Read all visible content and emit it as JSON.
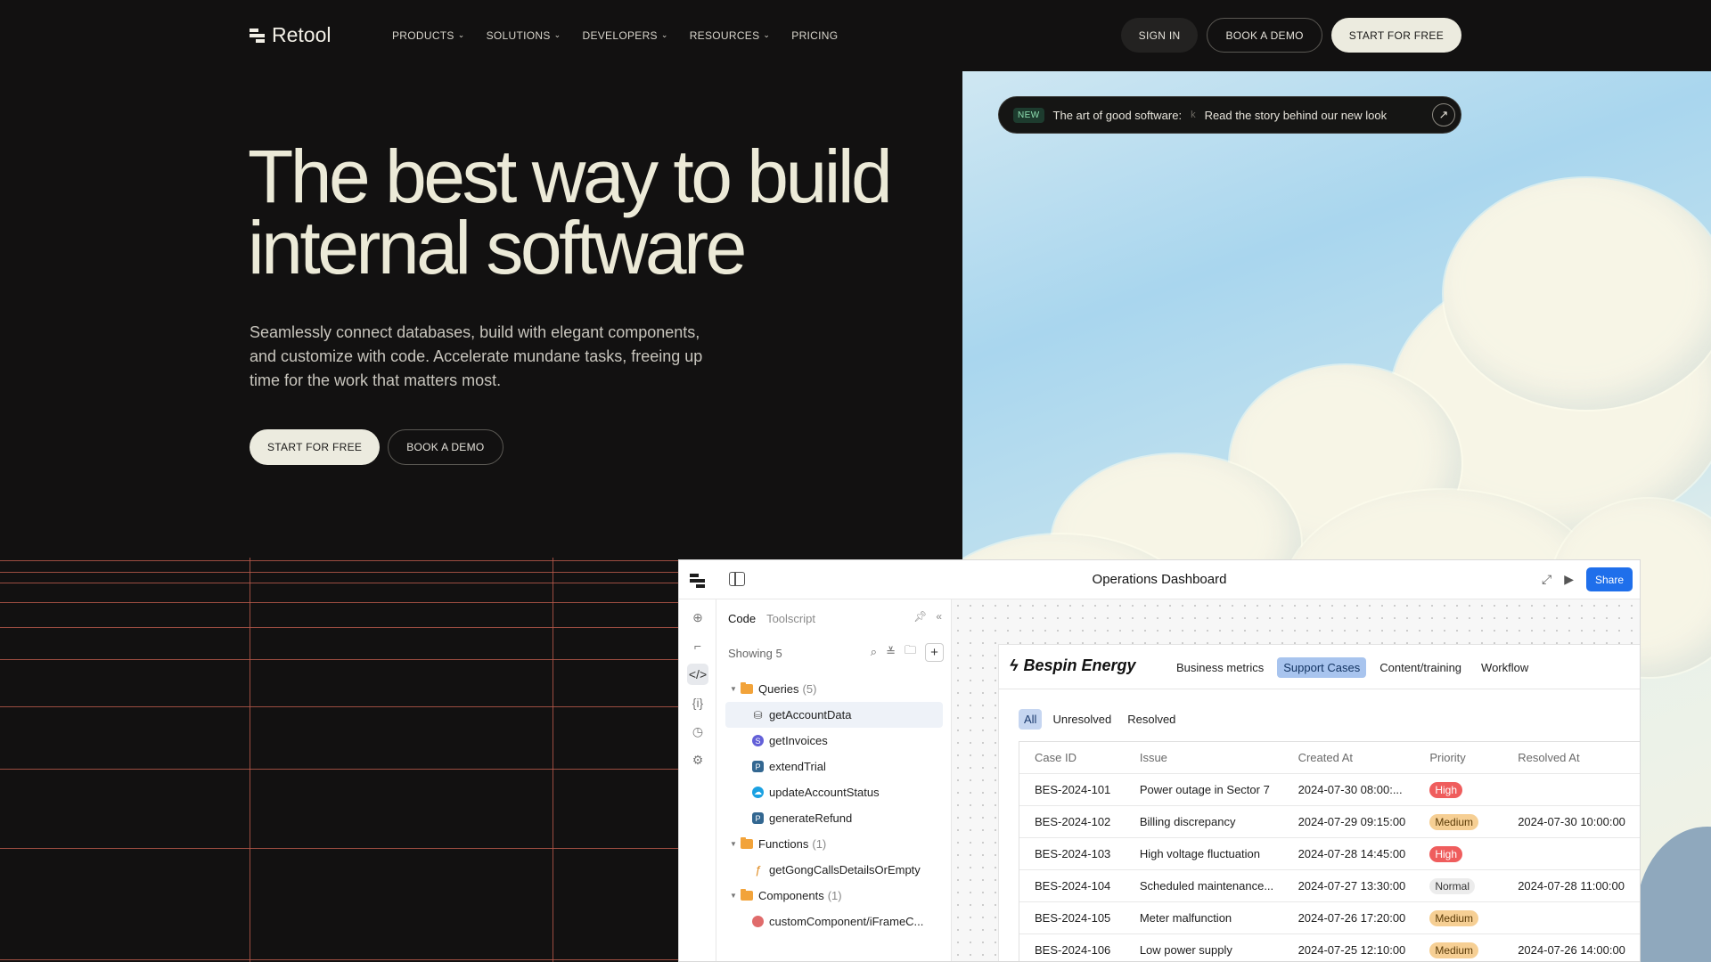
{
  "nav": {
    "brand": "Retool",
    "links": [
      {
        "label": "PRODUCTS",
        "has_menu": true
      },
      {
        "label": "SOLUTIONS",
        "has_menu": true
      },
      {
        "label": "DEVELOPERS",
        "has_menu": true
      },
      {
        "label": "RESOURCES",
        "has_menu": true
      },
      {
        "label": "PRICING",
        "has_menu": false
      }
    ],
    "sign_in": "SIGN IN",
    "book_demo": "BOOK A DEMO",
    "start_free": "START FOR FREE"
  },
  "hero": {
    "title_line1": "The best way to build",
    "title_line2": "internal software",
    "subtitle": "Seamlessly connect databases, build with elegant components, and customize with code. Accelerate mundane tasks, freeing up time for the work that matters most.",
    "cta_primary": "START FOR FREE",
    "cta_secondary": "BOOK A DEMO"
  },
  "announcement": {
    "badge": "NEW",
    "text": "The art of good software:",
    "separator": "k",
    "link": "Read the story behind our new look"
  },
  "app": {
    "title": "Operations Dashboard",
    "share": "Share",
    "code_panel": {
      "tab_code": "Code",
      "tab_toolscript": "Toolscript",
      "showing": "Showing 5",
      "tree": [
        {
          "type": "folder",
          "label": "Queries",
          "count": "(5)"
        },
        {
          "type": "item",
          "label": "getAccountData",
          "icon": "database-icon",
          "selected": true
        },
        {
          "type": "item",
          "label": "getInvoices",
          "icon": "stripe-icon"
        },
        {
          "type": "item",
          "label": "extendTrial",
          "icon": "postgres-icon"
        },
        {
          "type": "item",
          "label": "updateAccountStatus",
          "icon": "salesforce-icon"
        },
        {
          "type": "item",
          "label": "generateRefund",
          "icon": "postgres-icon"
        },
        {
          "type": "folder",
          "label": "Functions",
          "count": "(1)"
        },
        {
          "type": "item",
          "label": "getGongCallsDetailsOrEmpty",
          "icon": "function-icon"
        },
        {
          "type": "folder",
          "label": "Components",
          "count": "(1)"
        },
        {
          "type": "item",
          "label": "customComponent/iFrameC...",
          "icon": "component-icon"
        }
      ]
    },
    "inner": {
      "brand": "Bespin Energy",
      "nav": [
        "Business metrics",
        "Support Cases",
        "Content/training",
        "Workflow"
      ],
      "active_nav": "Support Cases",
      "filters": [
        "All",
        "Unresolved",
        "Resolved"
      ],
      "active_filter": "All",
      "columns": [
        "Case ID",
        "Issue",
        "Created At",
        "Priority",
        "Resolved At"
      ],
      "rows": [
        {
          "id": "BES-2024-101",
          "issue": "Power outage in Sector 7",
          "created": "2024-07-30 08:00:...",
          "priority": "High",
          "resolved": ""
        },
        {
          "id": "BES-2024-102",
          "issue": "Billing discrepancy",
          "created": "2024-07-29 09:15:00",
          "priority": "Medium",
          "resolved": "2024-07-30 10:00:00"
        },
        {
          "id": "BES-2024-103",
          "issue": "High voltage fluctuation",
          "created": "2024-07-28 14:45:00",
          "priority": "High",
          "resolved": ""
        },
        {
          "id": "BES-2024-104",
          "issue": "Scheduled maintenance...",
          "created": "2024-07-27 13:30:00",
          "priority": "Normal",
          "resolved": "2024-07-28 11:00:00"
        },
        {
          "id": "BES-2024-105",
          "issue": "Meter malfunction",
          "created": "2024-07-26 17:20:00",
          "priority": "Medium",
          "resolved": ""
        },
        {
          "id": "BES-2024-106",
          "issue": "Low power supply",
          "created": "2024-07-25 12:10:00",
          "priority": "Medium",
          "resolved": "2024-07-26 14:00:00"
        }
      ]
    }
  },
  "colors": {
    "background": "#121111",
    "accent_blue": "#1f6feb",
    "grid_lines": "#b5584a",
    "badge_high": "#ef5d5d",
    "badge_medium": "#f6cf94"
  }
}
